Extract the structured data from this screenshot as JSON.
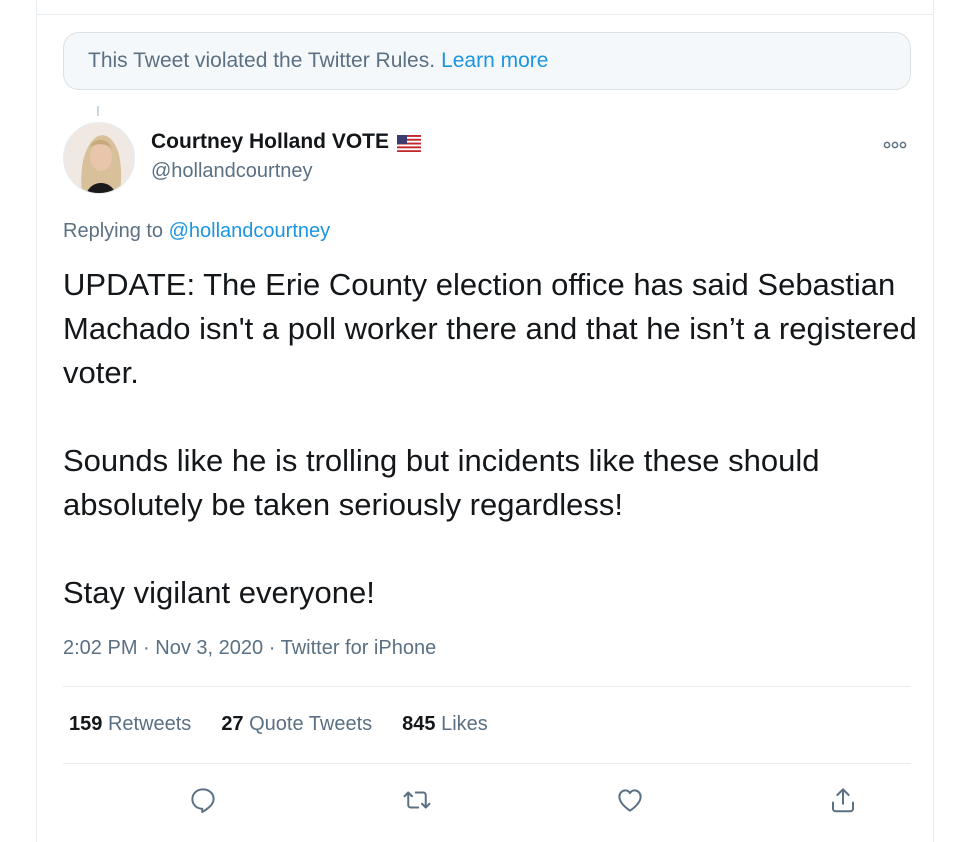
{
  "notice": {
    "text": "This Tweet violated the Twitter Rules.",
    "link": "Learn more"
  },
  "author": {
    "display_name": "Courtney Holland VOTE",
    "flag_icon": "us-flag-icon",
    "handle": "@hollandcourtney"
  },
  "reply": {
    "prefix": "Replying to",
    "mention": "@hollandcourtney"
  },
  "tweet": {
    "paragraphs": [
      "UPDATE: The Erie County election office has said Sebastian Machado isn't a poll worker there and that he isn’t a registered voter.",
      "Sounds like he is trolling but incidents like these should absolutely be taken seriously regardless!",
      "Stay vigilant everyone!"
    ]
  },
  "meta": {
    "time": "2:02 PM",
    "date": "Nov 3, 2020",
    "separator": "·",
    "source": "Twitter for iPhone"
  },
  "stats": {
    "retweets_count": "159",
    "retweets_label": "Retweets",
    "quotes_count": "27",
    "quotes_label": "Quote Tweets",
    "likes_count": "845",
    "likes_label": "Likes"
  },
  "icons": {
    "reply": "reply-icon",
    "retweet": "retweet-icon",
    "like": "heart-icon",
    "share": "share-icon",
    "more": "more-icon"
  },
  "colors": {
    "link": "#1b95e0",
    "secondary_text": "#5b7083",
    "primary_text": "#14171a",
    "notice_bg": "#f5f8fa"
  }
}
